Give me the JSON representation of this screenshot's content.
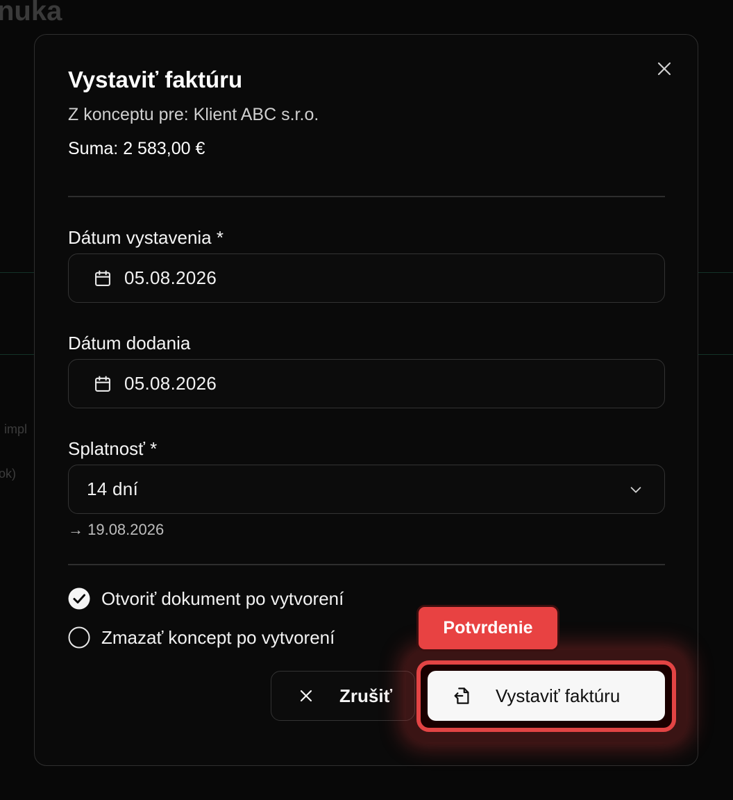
{
  "background": {
    "title": "nuka",
    "fragments": [
      "impl",
      "ok)"
    ]
  },
  "dialog": {
    "title": "Vystaviť faktúru",
    "subtitle": "Z konceptu pre: Klient ABC s.r.o.",
    "sum": "Suma: 2 583,00 €",
    "issue_date": {
      "label": "Dátum vystavenia *",
      "value": "05.08.2026"
    },
    "delivery_date": {
      "label": "Dátum dodania",
      "value": "05.08.2026"
    },
    "due": {
      "label": "Splatnosť *",
      "value": "14 dní",
      "hint": "→ 19.08.2026"
    },
    "options": [
      {
        "label": "Otvoriť dokument po vytvorení",
        "checked": true
      },
      {
        "label": "Zmazať koncept po vytvorení",
        "checked": false
      }
    ],
    "cancel_label": "Zrušiť",
    "submit_label": "Vystaviť faktúru",
    "badge_label": "Potvrdenie"
  },
  "colors": {
    "accent_red": "#e84242",
    "dialog_bg": "#0a0a0a",
    "border": "#333333"
  }
}
